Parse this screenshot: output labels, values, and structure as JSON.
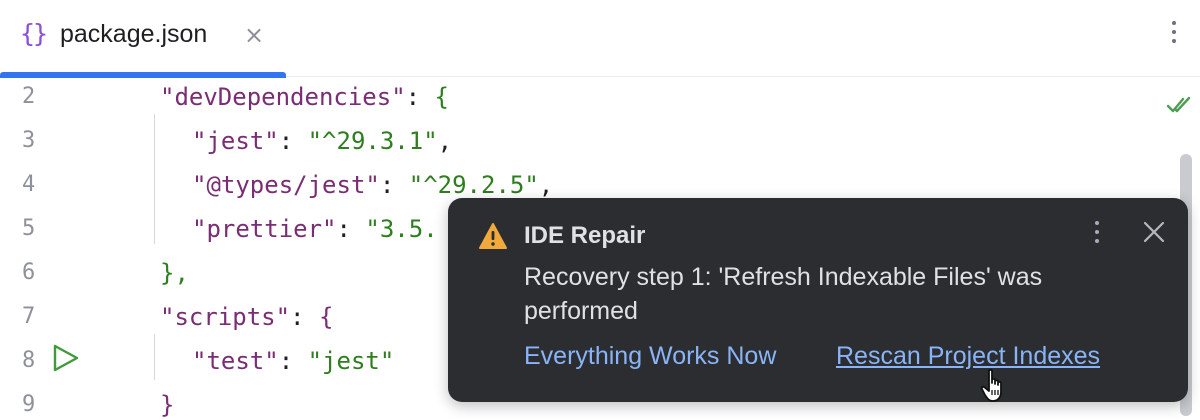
{
  "tab": {
    "icon": "json-braces-icon",
    "icon_glyph": "{}",
    "filename": "package.json",
    "close_glyph": "×",
    "accent_color": "#3574f0"
  },
  "editor": {
    "line_numbers": [
      "2",
      "3",
      "4",
      "5",
      "6",
      "7",
      "8",
      "9"
    ],
    "lines": [
      {
        "indent": 0,
        "key": "\"devDependencies\"",
        "sep": ": ",
        "value": "",
        "tail": "{"
      },
      {
        "indent": 1,
        "key": "\"jest\"",
        "sep": ": ",
        "value": "\"^29.3.1\"",
        "tail": ","
      },
      {
        "indent": 1,
        "key": "\"@types/jest\"",
        "sep": ": ",
        "value": "\"^29.2.5\"",
        "tail": ","
      },
      {
        "indent": 1,
        "key": "\"prettier\"",
        "sep": ": ",
        "value": "\"3.5.",
        "tail": ""
      },
      {
        "indent": 0,
        "key": "",
        "sep": "",
        "value": "",
        "tail": "},"
      },
      {
        "indent": 0,
        "key": "\"scripts\"",
        "sep": ": ",
        "value": "",
        "tail": "{"
      },
      {
        "indent": 1,
        "key": "\"test\"",
        "sep": ": ",
        "value": "\"jest\"",
        "tail": ""
      },
      {
        "indent": 0,
        "key": "",
        "sep": "",
        "value": "",
        "tail": "}"
      }
    ],
    "colors": {
      "key": "#7a2c74",
      "string": "#2e7d1f",
      "line_number": "#8e9199"
    }
  },
  "notification": {
    "title": "IDE Repair",
    "message": "Recovery step 1: 'Refresh Indexable Files' was performed",
    "actions": [
      "Everything Works Now",
      "Rescan Project Indexes"
    ],
    "background": "#2b2d30",
    "link_color": "#8ab4f8",
    "warning_color": "#f2a93b"
  }
}
